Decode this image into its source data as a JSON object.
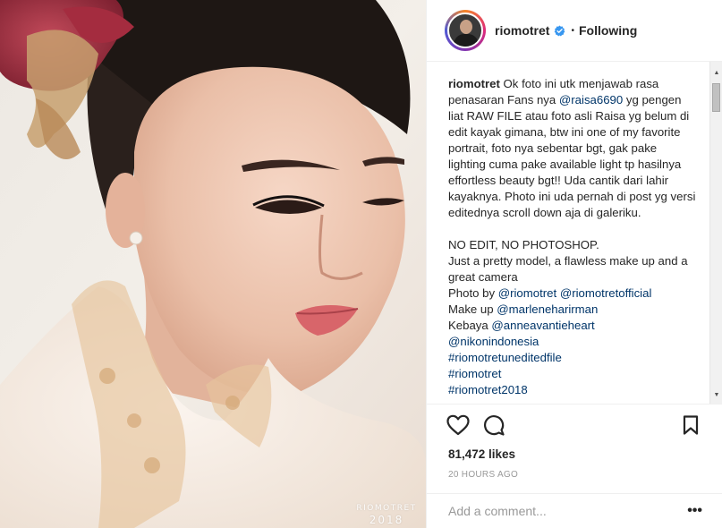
{
  "header": {
    "username": "riomotret",
    "separator": "•",
    "follow_status": "Following",
    "verified_icon": "verified-badge-icon",
    "accent_color": "#3897f0"
  },
  "photo": {
    "watermark_name": "RIOMOTRET",
    "watermark_year": "2018"
  },
  "caption": {
    "username": "riomotret",
    "lines": [
      " Ok foto ini utk menjawab rasa penasaran Fans nya ",
      "@raisa6690",
      " yg pengen liat RAW FILE atau foto asli Raisa yg belum di edit kayak gimana, btw ini one of my favorite portrait, foto nya sebentar bgt, gak pake lighting cuma pake available light tp hasilnya effortless beauty bgt!! Uda cantik dari lahir kayaknya. Photo ini uda pernah di post yg versi editednya scroll down aja di galeriku."
    ],
    "no_edit": "NO EDIT, NO PHOTOSHOP.",
    "pretty": "Just a pretty model, a flawless make up and a great camera",
    "photo_by_label": "Photo by ",
    "photo_by_1": "@riomotret",
    "photo_by_2": "@riomotretofficial",
    "makeup_label": "Make up ",
    "makeup": "@marleneharirman",
    "kebaya_label": "Kebaya ",
    "kebaya": "@anneavantieheart",
    "nikon": "@nikonindonesia",
    "tag1": "#riomotretuneditedfile",
    "tag2": "#riomotret",
    "tag3": "#riomotret2018"
  },
  "actions": {
    "like_icon": "heart-icon",
    "comment_icon": "comment-icon",
    "save_icon": "bookmark-icon"
  },
  "likes": "81,472 likes",
  "timestamp": "20 HOURS AGO",
  "comment_box": {
    "placeholder": "Add a comment...",
    "more": "•••"
  }
}
